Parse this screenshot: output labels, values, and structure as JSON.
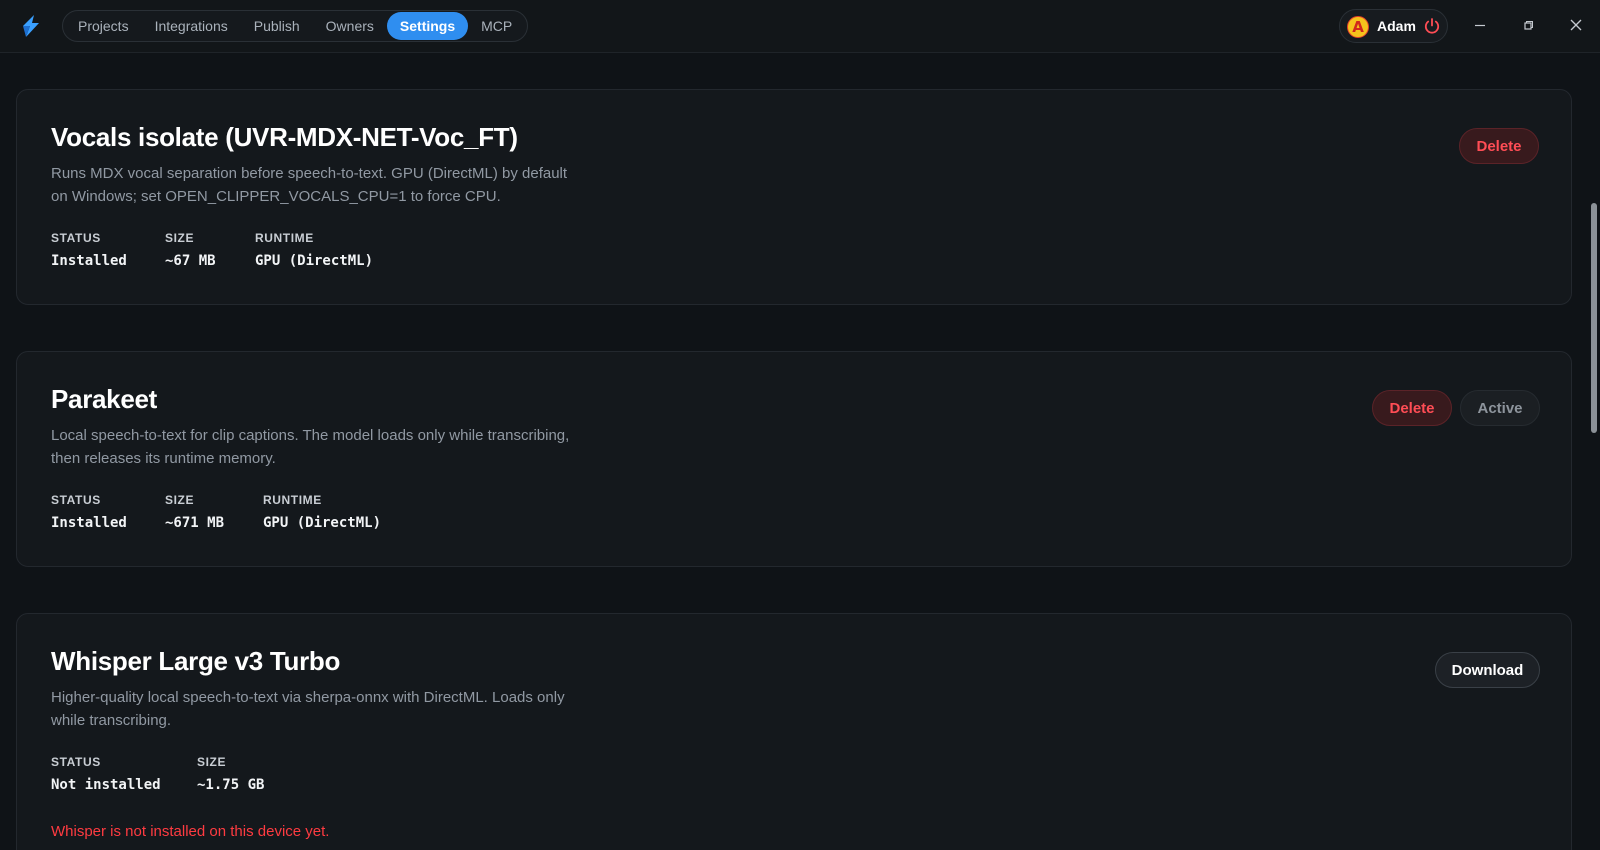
{
  "nav": {
    "tabs": [
      {
        "label": "Projects"
      },
      {
        "label": "Integrations"
      },
      {
        "label": "Publish"
      },
      {
        "label": "Owners"
      },
      {
        "label": "Settings",
        "active": true
      },
      {
        "label": "MCP"
      }
    ]
  },
  "user": {
    "initial": "A",
    "name": "Adam"
  },
  "window_controls": [
    "minimize-icon",
    "restore-icon",
    "close-icon"
  ],
  "colors": {
    "accent": "#2f8ef0",
    "danger": "#ff4d55",
    "background": "#0f1317",
    "card": "#14181c"
  },
  "models": [
    {
      "title": "Vocals isolate (UVR-MDX-NET-Voc_FT)",
      "description": "Runs MDX vocal separation before speech-to-text. GPU (DirectML) by default on Windows; set OPEN_CLIPPER_VOCALS_CPU=1 to force CPU.",
      "status_label": "STATUS",
      "status": "Installed",
      "size_label": "SIZE",
      "size": "~67 MB",
      "runtime_label": "RUNTIME",
      "runtime": "GPU (DirectML)",
      "delete_label": "Delete"
    },
    {
      "title": "Parakeet",
      "description": "Local speech-to-text for clip captions. The model loads only while transcribing, then releases its runtime memory.",
      "status_label": "STATUS",
      "status": "Installed",
      "size_label": "SIZE",
      "size": "~671 MB",
      "runtime_label": "RUNTIME",
      "runtime": "GPU (DirectML)",
      "delete_label": "Delete",
      "active_label": "Active"
    },
    {
      "title": "Whisper Large v3 Turbo",
      "description": "Higher-quality local speech-to-text via sherpa-onnx with DirectML. Loads only while transcribing.",
      "status_label": "STATUS",
      "status": "Not installed",
      "size_label": "SIZE",
      "size": "~1.75 GB",
      "download_label": "Download",
      "warning": "Whisper is not installed on this device yet."
    }
  ]
}
